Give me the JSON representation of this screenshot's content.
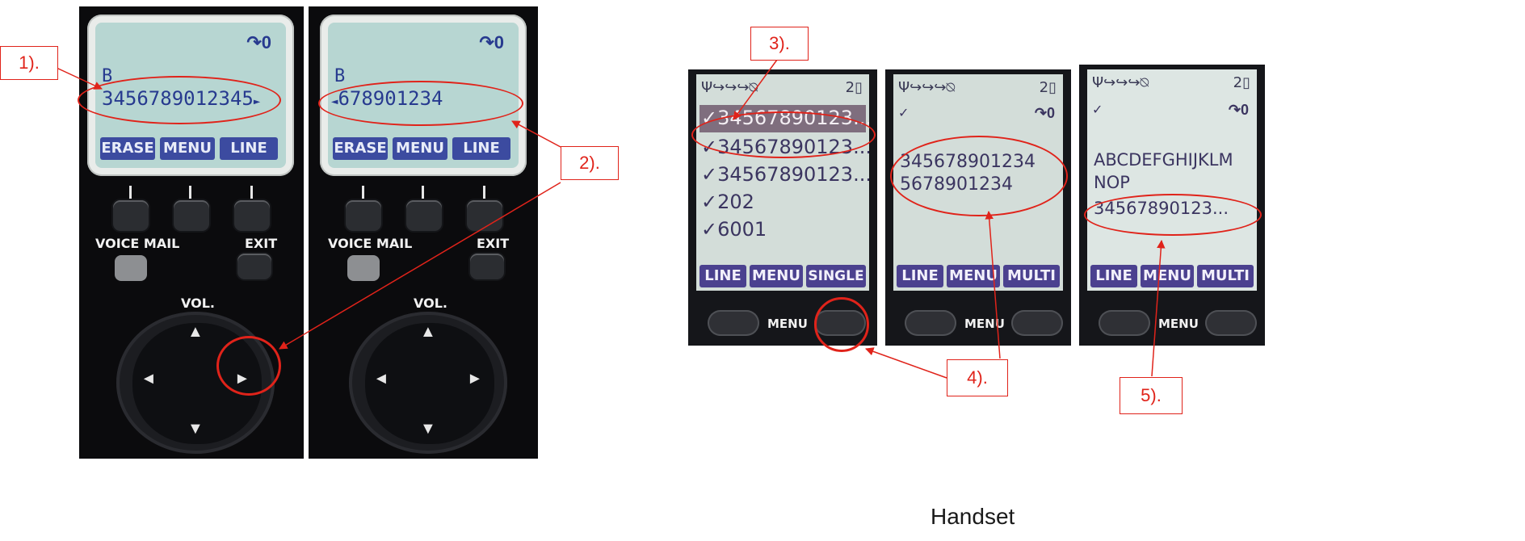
{
  "caption": "Handset",
  "callouts": [
    "1).",
    "2).",
    "3).",
    "4).",
    "5)."
  ],
  "deskphone_left": {
    "line1": "B",
    "line2": "3456789012345",
    "scroll_right_glyph": "►",
    "softkeys": [
      "ERASE",
      "MENU",
      "LINE"
    ],
    "voice_mail_label": "VOICE MAIL",
    "exit_label": "EXIT",
    "vol_label": "VOL."
  },
  "deskphone_right": {
    "line1": "B",
    "scroll_left_glyph": "◄",
    "line2": "678901234",
    "softkeys": [
      "ERASE",
      "MENU",
      "LINE"
    ],
    "voice_mail_label": "VOICE MAIL",
    "exit_label": "EXIT",
    "vol_label": "VOL."
  },
  "handset_1": {
    "status_icons": "Ψ↪↪↪⍉",
    "battery": "2",
    "entries": [
      "✓34567890123...",
      "✓34567890123...",
      "✓34567890123...",
      "✓202",
      "✓6001"
    ],
    "softkeys": [
      "LINE",
      "MENU",
      "SINGLE"
    ],
    "menu_label": "MENU"
  },
  "handset_2": {
    "status_icons": "Ψ↪↪↪⍉",
    "battery": "2",
    "check": "✓",
    "line1": "345678901234",
    "line2": "5678901234",
    "softkeys": [
      "LINE",
      "MENU",
      "MULTI"
    ],
    "menu_label": "MENU"
  },
  "handset_3": {
    "status_icons": "Ψ↪↪↪⍉",
    "battery": "2",
    "check": "✓",
    "line1": "ABCDEFGHIJKLM",
    "line2": "NOP",
    "line3": "34567890123...",
    "softkeys": [
      "LINE",
      "MENU",
      "MULTI"
    ],
    "menu_label": "MENU"
  },
  "icons": {
    "handset_icon": "call-hold-icon",
    "arrow_up": "▲",
    "arrow_down": "▼",
    "arrow_left": "◄",
    "arrow_right": "►"
  },
  "colors": {
    "annotation": "#e0231a",
    "lcd_text": "#273a8f",
    "handset_softkey": "#4b418f"
  }
}
